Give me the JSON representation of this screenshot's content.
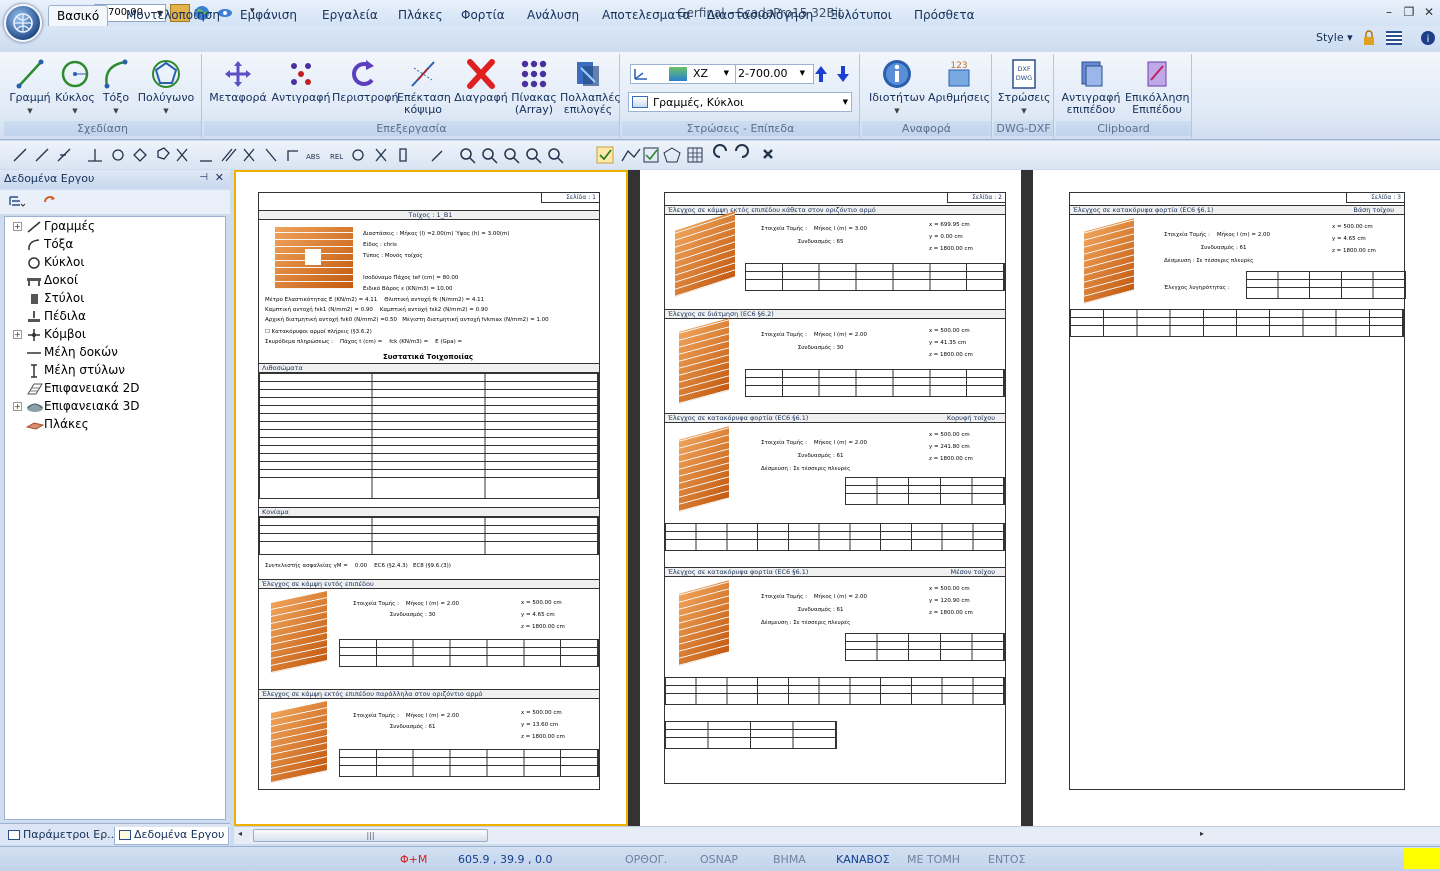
{
  "window": {
    "title": "Gerfinal - ScadaPro15 32Bit",
    "level": "2-700.00",
    "style_label": "Style"
  },
  "tabs": [
    "Βασικό",
    "Μοντελοποίηση",
    "Εμφάνιση",
    "Εργαλεία",
    "Πλάκες",
    "Φορτία",
    "Ανάλυση",
    "Αποτελεσματα",
    "Διαστασιολόγηση",
    "Ξυλότυποι",
    "Πρόσθετα"
  ],
  "ribbon": {
    "sxediasi": {
      "label": "Σχεδίαση",
      "btns": [
        "Γραμμή",
        "Κύκλος",
        "Τόξο",
        "Πολύγωνο"
      ]
    },
    "epexergasia": {
      "label": "Επεξεργασία",
      "btns": [
        "Μεταφορά",
        "Αντιγραφή",
        "Περιστροφή",
        "Επέκταση κόψιμο",
        "Διαγραφή",
        "Πίνακας (Array)",
        "Πολλαπλές επιλογές"
      ]
    },
    "stroseis": {
      "label": "Στρώσεις - Επίπεδα",
      "plane": "XZ",
      "level": "2-700.00",
      "layer": "Γραμμές, Κύκλοι"
    },
    "anafora": {
      "label": "Αναφορά",
      "btns": [
        "Ιδιοτήτων",
        "Αριθμήσεις"
      ]
    },
    "dwg": {
      "label": "DWG-DXF",
      "btns": [
        "Στρώσεις"
      ]
    },
    "clipboard": {
      "label": "Clipboard",
      "btns": [
        "Αντιγραφή επιπέδου",
        "Επικόλληση Επιπέδου"
      ]
    }
  },
  "left_panel": {
    "title": "Δεδομένα Εργου",
    "tree": [
      "Γραμμές",
      "Τόξα",
      "Κύκλοι",
      "Δοκοί",
      "Στύλοι",
      "Πέδιλα",
      "Κόμβοι",
      "Μέλη δοκών",
      "Μέλη στύλων",
      "Επιφανειακά 2D",
      "Επιφανειακά 3D",
      "Πλάκες"
    ],
    "tabs": [
      "Παράμετροι Ερ...",
      "Δεδομένα Εργου"
    ]
  },
  "pages": {
    "p1": {
      "hdr": "Σελίδα : 1",
      "title": "Τοίχος : 1_B1",
      "section": "Συστατικά Τοιχοποιίας",
      "s1": "Λιθοσώματα",
      "s2": "Κονίαμα",
      "c1": "Έλεγχος σε κάμψη εντός επιπέδου",
      "c2": "Έλεγχος σε κάμψη εκτός επιπέδου παράλληλα στον οριζόντιο αρμό"
    },
    "p2": {
      "hdr": "Σελίδα : 2",
      "c1": "Έλεγχος σε κάμψη εκτός επιπέδου κάθετα στον οριζόντιο αρμό",
      "c2": "Έλεγχος σε διάτμηση (EC6 §6.2)",
      "c3": "Έλεγχος σε κατακόρυφα φορτία (EC6 §6.1)",
      "c3r": "Κορυφή τοίχου",
      "c4": "Έλεγχος σε κατακόρυφα φορτία (EC6 §6.1)",
      "c4r": "Μέσον τοίχου"
    },
    "p3": {
      "hdr": "Σελίδα : 3",
      "c1": "Έλεγχος σε κατακόρυφα φορτία (EC6 §6.1)",
      "c1r": "Βάση τοίχου"
    }
  },
  "status": {
    "phi": "Φ+Μ",
    "coords": "605.9 , 39.9 , 0.0",
    "items": [
      "ΟΡΘΟΓ.",
      "OSNAP",
      "ΒΗΜΑ",
      "ΚΑΝΑΒΟΣ",
      "ΜΕ ΤΟΜΗ",
      "ΕΝΤΟΣ"
    ]
  },
  "colors": {
    "accent": "#15305a",
    "status_yellow": "#ffff00",
    "brick": "#d96f20",
    "delete_red": "#e02020"
  }
}
